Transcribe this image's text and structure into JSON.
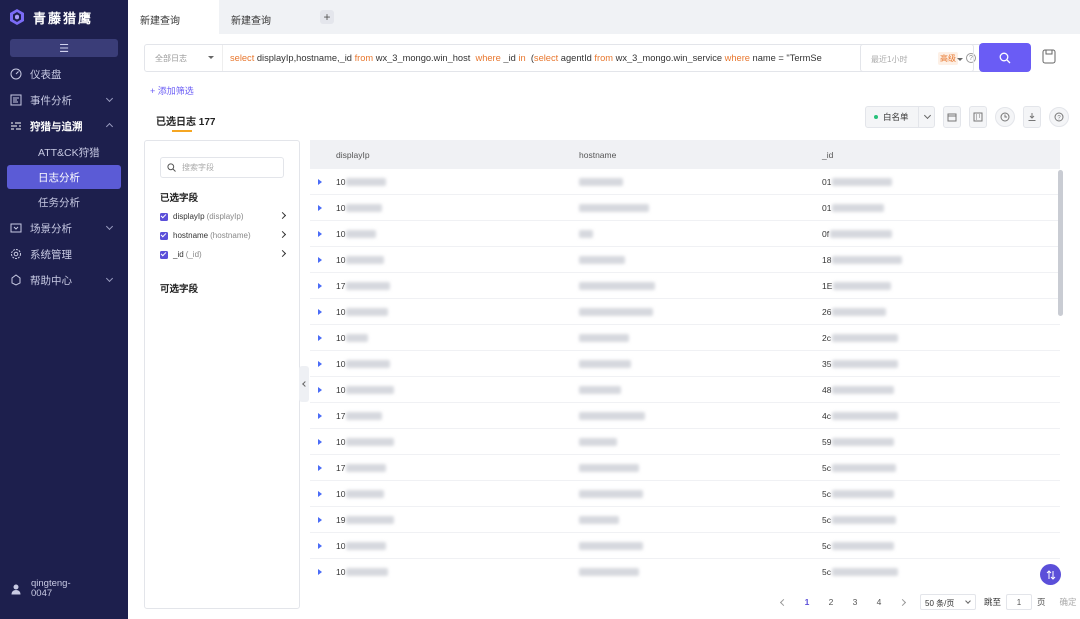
{
  "app": {
    "name": "青藤猎鹰"
  },
  "sidebar": {
    "collapse_icon": "menu-icon",
    "items": [
      {
        "label": "仪表盘",
        "icon": "dashboard-icon"
      },
      {
        "label": "事件分析",
        "icon": "event-icon"
      },
      {
        "label": "狩猎与追溯",
        "icon": "hunt-icon"
      },
      {
        "label": "场景分析",
        "icon": "scene-icon"
      },
      {
        "label": "系统管理",
        "icon": "gear-icon"
      },
      {
        "label": "帮助中心",
        "icon": "help-icon"
      }
    ],
    "sub_items": [
      {
        "label": "ATT&CK狩猎"
      },
      {
        "label": "日志分析"
      },
      {
        "label": "任务分析"
      }
    ],
    "user": "qingteng-0047"
  },
  "tabs": [
    {
      "label": "新建查询"
    },
    {
      "label": "新建查询"
    }
  ],
  "query": {
    "log_source": "全部日志",
    "sql": [
      {
        "t": "select",
        "k": true
      },
      {
        "t": " displayIp,hostname,_id ",
        "k": false
      },
      {
        "t": "from",
        "k": true
      },
      {
        "t": " wx_3_mongo.win_host  ",
        "k": false
      },
      {
        "t": "where",
        "k": true
      },
      {
        "t": " _id ",
        "k": false
      },
      {
        "t": "in",
        "k": true
      },
      {
        "t": "  (",
        "k": false
      },
      {
        "t": "select",
        "k": true
      },
      {
        "t": " agentId ",
        "k": false
      },
      {
        "t": "from",
        "k": true
      },
      {
        "t": " wx_3_mongo.win_service ",
        "k": false
      },
      {
        "t": "where",
        "k": true
      },
      {
        "t": " name = \"TermSe",
        "k": false
      }
    ],
    "advanced_badge": "高级",
    "time_range": "最近1小时",
    "add_filter": "+ 添加筛选"
  },
  "results": {
    "title": "已选日志 177",
    "whitelist_label": "白名单"
  },
  "fields": {
    "search_placeholder": "搜索字段",
    "selected_heading": "已选字段",
    "selected": [
      {
        "name": "displayIp",
        "alias": "(displayIp)"
      },
      {
        "name": "hostname",
        "alias": "(hostname)"
      },
      {
        "name": "_id",
        "alias": "(_id)"
      }
    ],
    "optional_heading": "可选字段"
  },
  "table": {
    "columns": [
      "displayIp",
      "hostname",
      "_id"
    ],
    "rows": [
      {
        "ip": "10",
        "id": "01"
      },
      {
        "ip": "10",
        "id": "01"
      },
      {
        "ip": "10",
        "id": "0f"
      },
      {
        "ip": "10",
        "id": "18"
      },
      {
        "ip": "17",
        "id": "1E"
      },
      {
        "ip": "10",
        "id": "26"
      },
      {
        "ip": "10",
        "id": "2c"
      },
      {
        "ip": "10",
        "id": "35"
      },
      {
        "ip": "10",
        "id": "48"
      },
      {
        "ip": "17",
        "id": "4c"
      },
      {
        "ip": "10",
        "id": "59"
      },
      {
        "ip": "17",
        "id": "5c"
      },
      {
        "ip": "10",
        "id": "5c"
      },
      {
        "ip": "19",
        "id": "5c"
      },
      {
        "ip": "10",
        "id": "5c"
      },
      {
        "ip": "10",
        "id": "5c"
      }
    ]
  },
  "pagination": {
    "pages": [
      "1",
      "2",
      "3",
      "4"
    ],
    "current": "1",
    "page_size": "50 条/页",
    "jump_label": "跳至",
    "jump_value": "1",
    "page_unit": "页",
    "confirm": "确定"
  },
  "colors": {
    "sidebar_bg": "#1d1f4d",
    "accent": "#6a5cf5",
    "keyword": "#e8772e"
  }
}
